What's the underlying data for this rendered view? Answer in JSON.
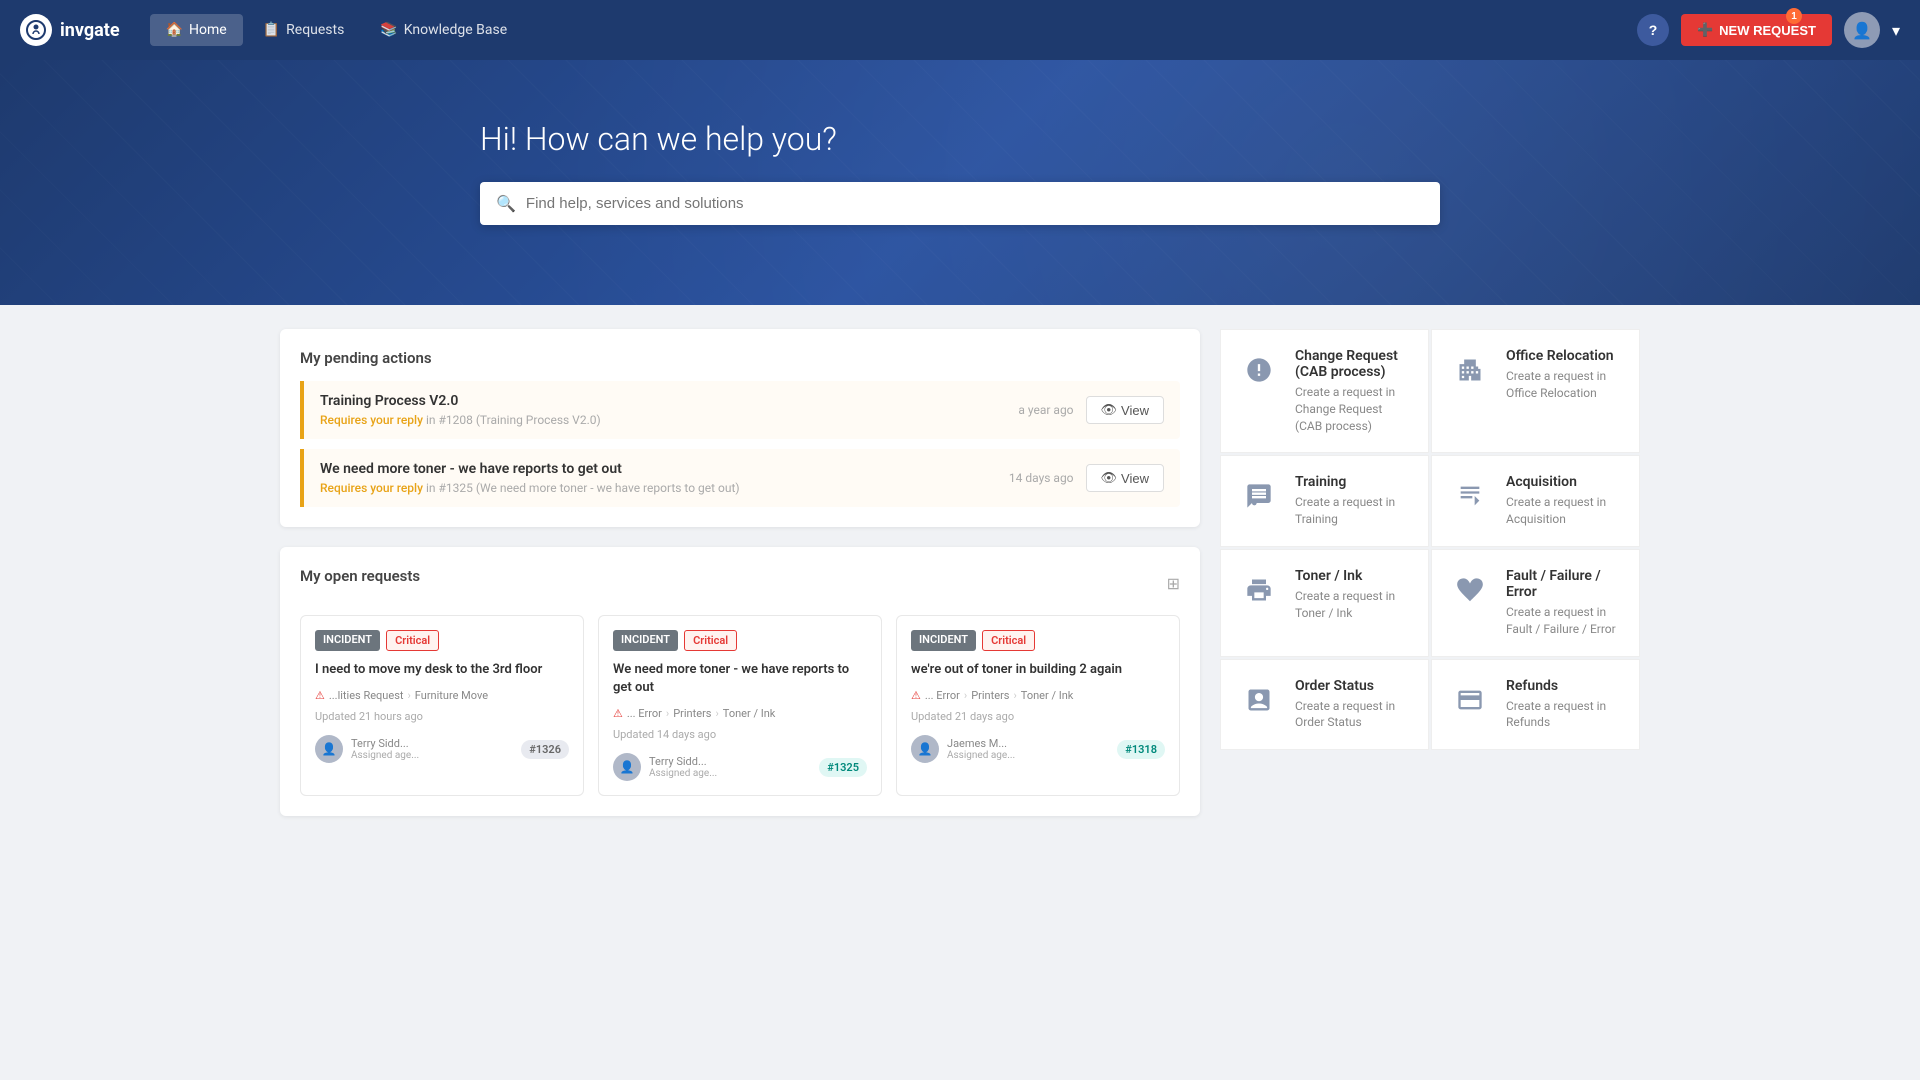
{
  "brand": {
    "name": "invgate",
    "logo_char": "i"
  },
  "nav": {
    "links": [
      {
        "label": "Home",
        "active": true,
        "icon": "home"
      },
      {
        "label": "Requests",
        "active": false,
        "icon": "requests"
      },
      {
        "label": "Knowledge Base",
        "active": false,
        "icon": "kb"
      }
    ],
    "new_request_label": "NEW REQUEST",
    "notification_count": "1"
  },
  "hero": {
    "heading": "Hi! How can we help you?",
    "search_placeholder": "Find help, services and solutions"
  },
  "pending": {
    "title": "My pending actions",
    "items": [
      {
        "title": "Training Process V2.0",
        "requires_text": "Requires your reply",
        "sub": "in #1208 (Training Process V2.0)",
        "time": "a year ago",
        "view_label": "View"
      },
      {
        "title": "We need more toner - we have reports to get out",
        "requires_text": "Requires your reply",
        "sub": "in #1325 (We need more toner - we have reports to get out)",
        "time": "14 days ago",
        "view_label": "View"
      }
    ]
  },
  "open_requests": {
    "title": "My open requests",
    "cards": [
      {
        "type": "INCIDENT",
        "priority": "Critical",
        "title": "I need to move my desk to the 3rd floor",
        "path": [
          "...lities Request",
          "Furniture Move"
        ],
        "updated": "Updated 21 hours ago",
        "user_name": "Terry Sidd...",
        "user_label": "Assigned age...",
        "ticket": "#1326",
        "ticket_style": "default"
      },
      {
        "type": "INCIDENT",
        "priority": "Critical",
        "title": "We need more toner - we have reports to get out",
        "path": [
          "... Error",
          "Printers",
          "Toner / Ink"
        ],
        "updated": "Updated 14 days ago",
        "user_name": "Terry Sidd...",
        "user_label": "Assigned age...",
        "ticket": "#1325",
        "ticket_style": "teal"
      },
      {
        "type": "INCIDENT",
        "priority": "Critical",
        "title": "we're out of toner in building 2 again",
        "path": [
          "... Error",
          "Printers",
          "Toner / Ink"
        ],
        "updated": "Updated 21 days ago",
        "user_name": "Jaemes M...",
        "user_label": "Assigned age...",
        "ticket": "#1318",
        "ticket_style": "teal"
      }
    ]
  },
  "catalog": {
    "items": [
      {
        "name": "Change Request (CAB process)",
        "desc": "Create a request in Change Request (CAB process)",
        "icon": "alert-circle"
      },
      {
        "name": "Office Relocation",
        "desc": "Create a request in Office Relocation",
        "icon": "building"
      },
      {
        "name": "Training",
        "desc": "Create a request in Training",
        "icon": "training"
      },
      {
        "name": "Acquisition",
        "desc": "Create a request in Acquisition",
        "icon": "acquisition"
      },
      {
        "name": "Toner / Ink",
        "desc": "Create a request in Toner / Ink",
        "icon": "printer"
      },
      {
        "name": "Fault / Failure / Error",
        "desc": "Create a request in Fault / Failure / Error",
        "icon": "broken-heart"
      },
      {
        "name": "Order Status",
        "desc": "Create a request in Order Status",
        "icon": "order"
      },
      {
        "name": "Refunds",
        "desc": "Create a request in Refunds",
        "icon": "refunds"
      }
    ]
  }
}
